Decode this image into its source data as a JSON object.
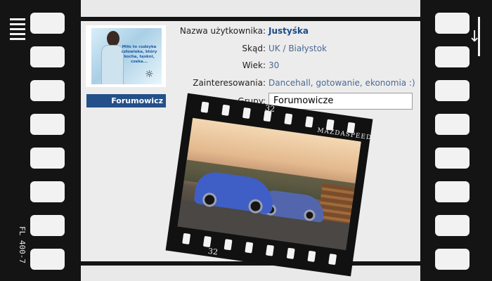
{
  "profile": {
    "avatar_caption": "Miło to cudzyka człowieka, który kocha, tęskni, czeka...",
    "rank_label": "Forumowicz",
    "fields": [
      {
        "label": "Nazwa użytkownika:",
        "value": "Justyśka"
      },
      {
        "label": "Skąd:",
        "value": "UK / Białystok"
      },
      {
        "label": "Wiek:",
        "value": "30"
      },
      {
        "label": "Zainteresowania:",
        "value": "Dancehall, gotowanie, ekonomia :)"
      },
      {
        "label": "Grupy:",
        "value": "Forumowicze"
      }
    ]
  },
  "film": {
    "left_code": "FL 400-7",
    "frame_number": "32",
    "frame_text": "MAZDASPEED"
  },
  "colors": {
    "rank_bar": "#24508a",
    "value_text": "#4a6a93",
    "username": "#1c4a86",
    "film": "#141414"
  }
}
